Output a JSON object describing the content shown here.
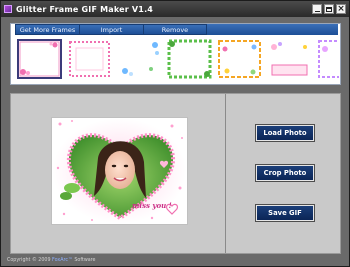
{
  "window": {
    "title": "Glitter Frame GIF Maker V1.4",
    "controls": [
      "minimize",
      "maximize",
      "close"
    ]
  },
  "gallery": {
    "tabs": [
      "Get More Frames",
      "Import",
      "Remove"
    ],
    "thumbnails": [
      {
        "name": "pink-flower-frame",
        "selected": true
      },
      {
        "name": "pink-border-frame",
        "selected": false
      },
      {
        "name": "blue-swirl-frame",
        "selected": false
      },
      {
        "name": "green-leaf-frame",
        "selected": false
      },
      {
        "name": "stars-frame",
        "selected": false
      },
      {
        "name": "bubble-frame",
        "selected": false
      },
      {
        "name": "purple-frame",
        "selected": false
      }
    ]
  },
  "preview": {
    "caption": "miss you !"
  },
  "buttons": {
    "load_photo": "Load Photo",
    "crop_photo": "Crop Photo",
    "save_gif": "Save GIF"
  },
  "footer": {
    "copyright": "Copyright © 2009 ",
    "brand": "FoxArc™",
    "suffix": " Software"
  },
  "colors": {
    "tab_blue": "#2a5ea8",
    "button_navy": "#12326b",
    "frame_pink": "#f06fb0",
    "window_gray": "#6a6a6a"
  }
}
